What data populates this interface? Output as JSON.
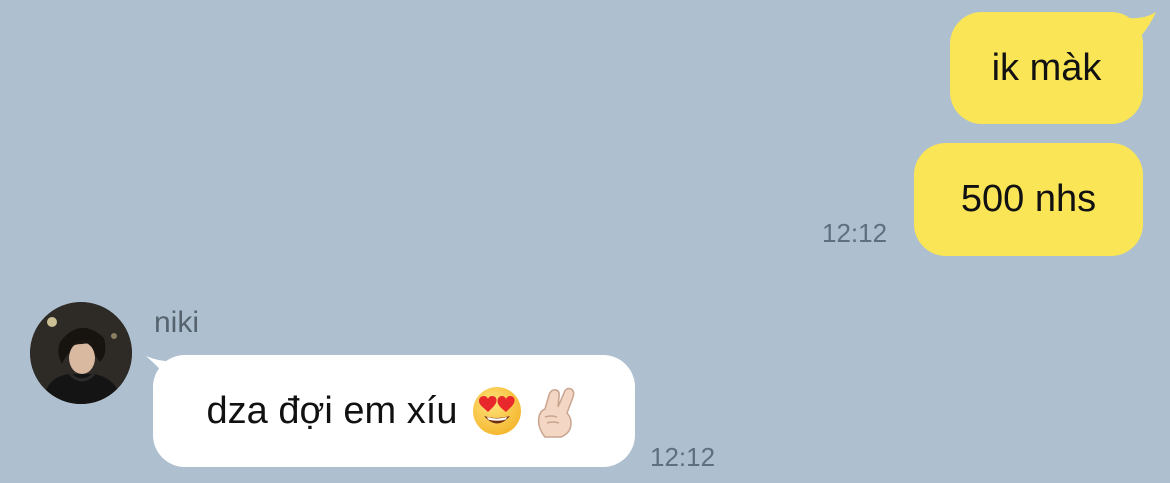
{
  "conversation": {
    "outgoing": [
      {
        "text": "ik màk"
      },
      {
        "text": "500 nhs",
        "time": "12:12"
      }
    ],
    "incoming": {
      "sender": "niki",
      "text": "dza đợi em xíu",
      "emojis": [
        "heart-eyes-emoji",
        "finger-heart-emoji"
      ],
      "time": "12:12"
    }
  },
  "colors": {
    "background": "#aec0cf",
    "outgoing_bubble": "#fae556",
    "incoming_bubble": "#ffffff",
    "timestamp": "#5f6f7e"
  }
}
